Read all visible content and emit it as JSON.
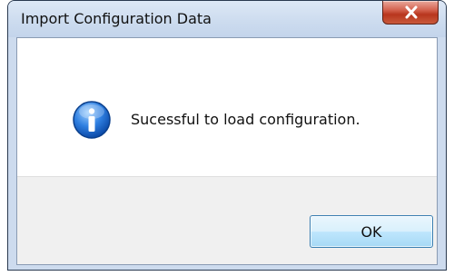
{
  "dialog": {
    "title": "Import Configuration Data",
    "message": "Sucessful to load configuration.",
    "ok_label": "OK",
    "close_icon": "close-icon",
    "message_icon": "info-icon"
  },
  "colors": {
    "close_button": "#c8452e",
    "ok_button_border": "#3c7fb1",
    "footer": "#f0f0f0",
    "frame": "#cddbee"
  }
}
